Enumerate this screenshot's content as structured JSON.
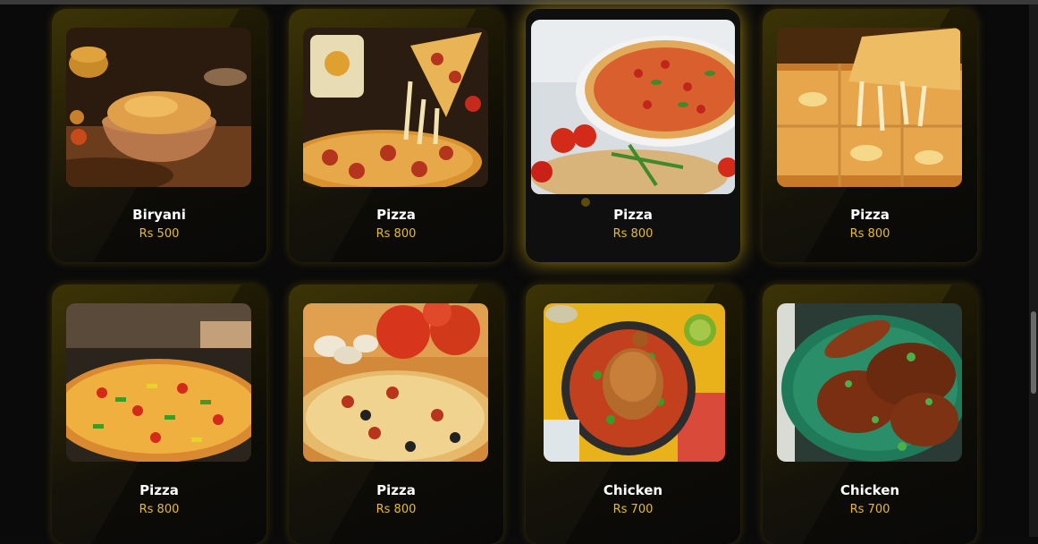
{
  "menu": {
    "items": [
      {
        "name": "Biryani",
        "price": "Rs 500",
        "image": "biryani-photo"
      },
      {
        "name": "Pizza",
        "price": "Rs 800",
        "image": "pepperoni-pizza-photo"
      },
      {
        "name": "Pizza",
        "price": "Rs 800",
        "image": "margherita-pizza-photo"
      },
      {
        "name": "Pizza",
        "price": "Rs 800",
        "image": "cheese-pizza-photo"
      },
      {
        "name": "Pizza",
        "price": "Rs 800",
        "image": "vegetable-pizza-photo"
      },
      {
        "name": "Pizza",
        "price": "Rs 800",
        "image": "mushroom-pizza-photo"
      },
      {
        "name": "Chicken",
        "price": "Rs 700",
        "image": "roast-chicken-photo"
      },
      {
        "name": "Chicken",
        "price": "Rs 700",
        "image": "grilled-chicken-photo"
      }
    ],
    "highlighted_index": 2
  },
  "colors": {
    "accent": "#e6bc2a",
    "card_glow": "#cdaa14",
    "background": "#0a0a0a"
  }
}
